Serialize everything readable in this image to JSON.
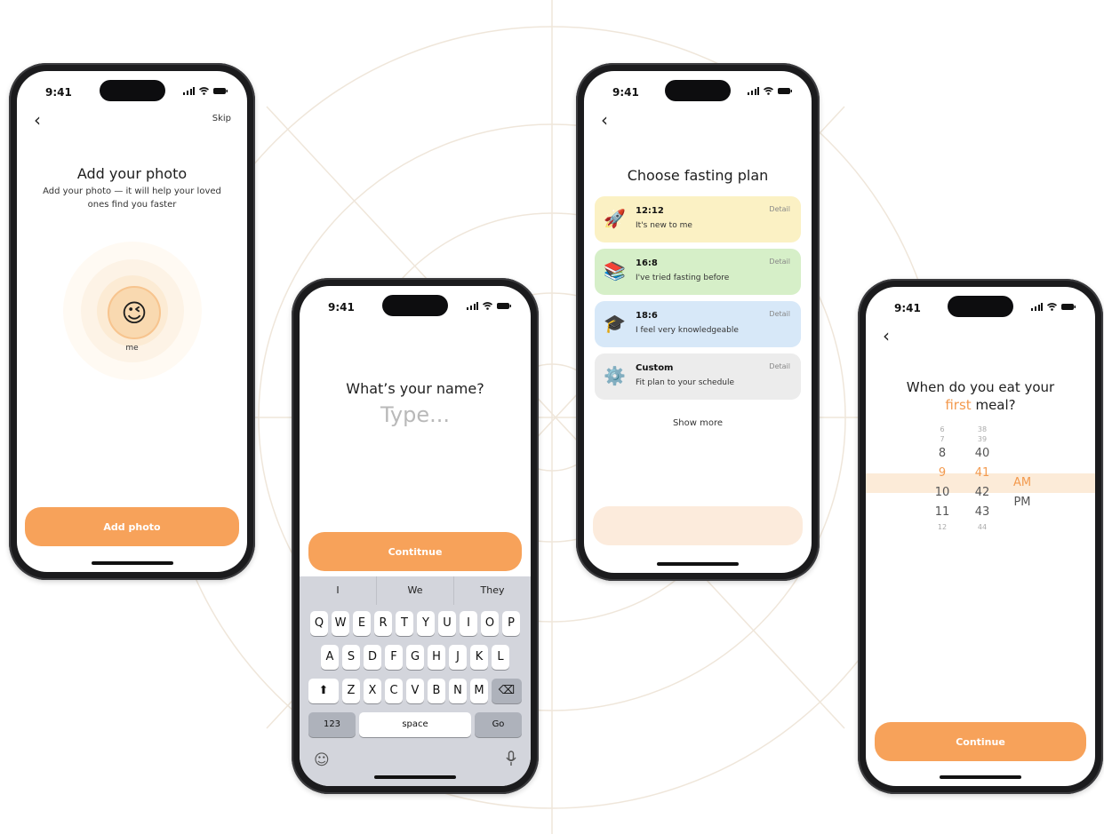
{
  "brand": {
    "accent": "#f7a25a",
    "accent_text": "#f39a4e",
    "band": "#fcebd8"
  },
  "status_bar": {
    "time": "9:41",
    "icons": [
      "signal-icon",
      "wifi-icon",
      "battery-icon"
    ]
  },
  "photo_screen": {
    "skip_label": "Skip",
    "title": "Add your photo",
    "subtitle": "Add your photo — it will help your loved ones find you faster",
    "avatar_label": "me",
    "avatar_emoji": "😉",
    "button_label": "Add photo"
  },
  "name_screen": {
    "title": "What’s your name?",
    "input_placeholder": "Type...",
    "button_label": "Contitnue",
    "keyboard": {
      "suggestions": [
        "I",
        "We",
        "They"
      ],
      "row1": [
        "Q",
        "W",
        "E",
        "R",
        "T",
        "Y",
        "U",
        "I",
        "O",
        "P"
      ],
      "row2": [
        "A",
        "S",
        "D",
        "F",
        "G",
        "H",
        "J",
        "K",
        "L"
      ],
      "row3": [
        "Z",
        "X",
        "C",
        "V",
        "B",
        "N",
        "M"
      ],
      "numbers_label": "123",
      "space_label": "space",
      "go_label": "Go"
    }
  },
  "fasting_screen": {
    "title": "Choose fasting plan",
    "plans": [
      {
        "emoji": "🚀",
        "name": "12:12",
        "desc": "It's new to me",
        "detail": "Detail",
        "color": "#fbf1c4"
      },
      {
        "emoji": "📚",
        "name": "16:8",
        "desc": "I've tried fasting before",
        "detail": "Detail",
        "color": "#d6efc8"
      },
      {
        "emoji": "🎓",
        "name": "18:6",
        "desc": "I feel very knowledgeable",
        "detail": "Detail",
        "color": "#d7e8f8"
      },
      {
        "emoji": "⚙️",
        "name": "Custom",
        "desc": "Fit plan to your schedule",
        "detail": "Detail",
        "color": "#ececec"
      }
    ],
    "show_more_label": "Show more"
  },
  "meal_screen": {
    "title_line1": "When do you eat your",
    "title_accent": "first",
    "title_rest": "meal?",
    "hours": [
      "6",
      "7",
      "8",
      "9",
      "10",
      "11",
      "12"
    ],
    "minutes": [
      "38",
      "39",
      "40",
      "41",
      "42",
      "43",
      "44"
    ],
    "periods": [
      "AM",
      "PM"
    ],
    "selected": {
      "hour": "9",
      "minute": "41",
      "period": "AM"
    },
    "button_label": "Continue"
  }
}
